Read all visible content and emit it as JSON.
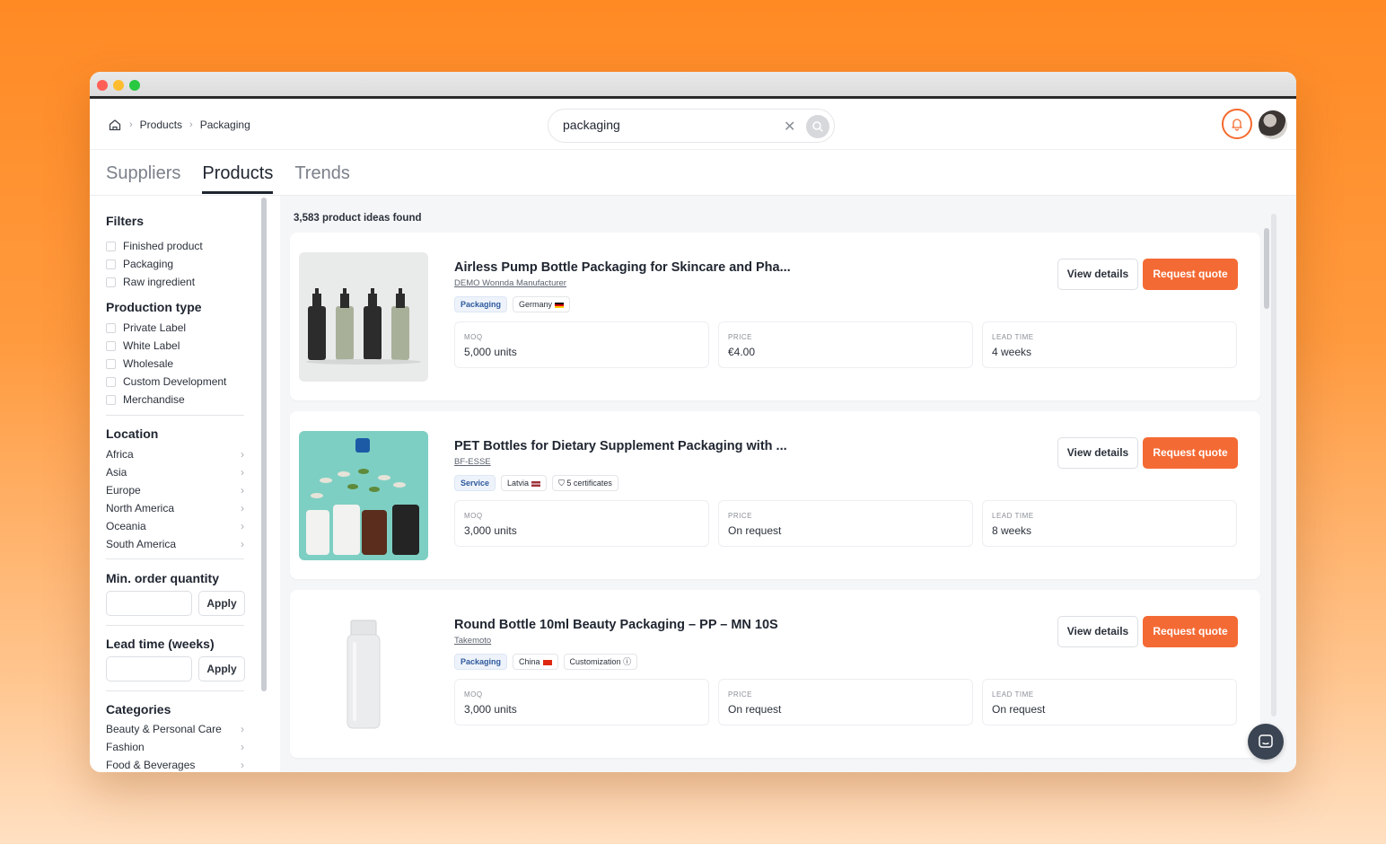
{
  "breadcrumb": {
    "items": [
      "Products",
      "Packaging"
    ]
  },
  "search": {
    "value": "packaging"
  },
  "tabs": [
    "Suppliers",
    "Products",
    "Trends"
  ],
  "filters": {
    "title": "Filters",
    "product_kind": [
      "Finished product",
      "Packaging",
      "Raw ingredient"
    ],
    "production_type": {
      "title": "Production type",
      "options": [
        "Private Label",
        "White Label",
        "Wholesale",
        "Custom Development",
        "Merchandise"
      ]
    },
    "location": {
      "title": "Location",
      "options": [
        "Africa",
        "Asia",
        "Europe",
        "North America",
        "Oceania",
        "South America"
      ]
    },
    "moq": {
      "title": "Min. order quantity",
      "apply": "Apply"
    },
    "lead_time": {
      "title": "Lead time (weeks)",
      "apply": "Apply"
    },
    "categories": {
      "title": "Categories",
      "options": [
        "Beauty & Personal Care",
        "Fashion",
        "Food & Beverages"
      ]
    }
  },
  "results": {
    "count_text": "3,583 product ideas found"
  },
  "labels": {
    "moq": "MOQ",
    "price": "PRICE",
    "lead_time": "LEAD TIME",
    "view": "View details",
    "quote": "Request quote"
  },
  "products": [
    {
      "title": "Airless Pump Bottle Packaging for Skincare and Pha...",
      "supplier": "DEMO Wonnda Manufacturer",
      "tags": [
        "Packaging",
        "Germany"
      ],
      "moq": "5,000 units",
      "price": "€4.00",
      "lead_time": "4 weeks"
    },
    {
      "title": "PET Bottles for Dietary Supplement Packaging with ...",
      "supplier": "BF-ESSE",
      "tags": [
        "Service",
        "Latvia",
        "5 certificates"
      ],
      "moq": "3,000 units",
      "price": "On request",
      "lead_time": "8 weeks"
    },
    {
      "title": "Round Bottle 10ml Beauty Packaging – PP – MN 10S",
      "supplier": "Takemoto",
      "tags": [
        "Packaging",
        "China",
        "Customization"
      ],
      "moq": "3,000 units",
      "price": "On request",
      "lead_time": "On request"
    }
  ],
  "colors": {
    "accent": "#f46a34",
    "tag_blue": "#2f5a9c"
  }
}
